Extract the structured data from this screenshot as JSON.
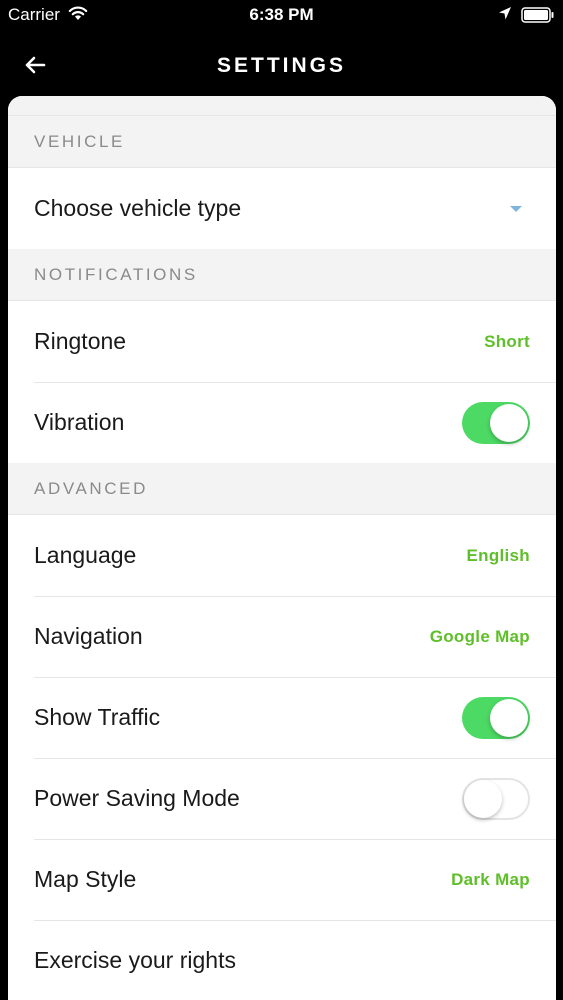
{
  "status_bar": {
    "carrier": "Carrier",
    "time": "6:38 PM"
  },
  "header": {
    "title": "SETTINGS"
  },
  "sections": {
    "vehicle": {
      "title": "VEHICLE",
      "vehicle_type_label": "Choose vehicle type"
    },
    "notifications": {
      "title": "NOTIFICATIONS",
      "ringtone_label": "Ringtone",
      "ringtone_value": "Short",
      "vibration_label": "Vibration",
      "vibration_on": true
    },
    "advanced": {
      "title": "ADVANCED",
      "language_label": "Language",
      "language_value": "English",
      "navigation_label": "Navigation",
      "navigation_value": "Google Map",
      "show_traffic_label": "Show Traffic",
      "show_traffic_on": true,
      "power_saving_label": "Power Saving Mode",
      "power_saving_on": false,
      "map_style_label": "Map Style",
      "map_style_value": "Dark Map",
      "rights_label": "Exercise your rights"
    }
  },
  "colors": {
    "accent_green": "#5fbf2a",
    "toggle_on": "#4cd964",
    "header_bg": "#000000"
  }
}
